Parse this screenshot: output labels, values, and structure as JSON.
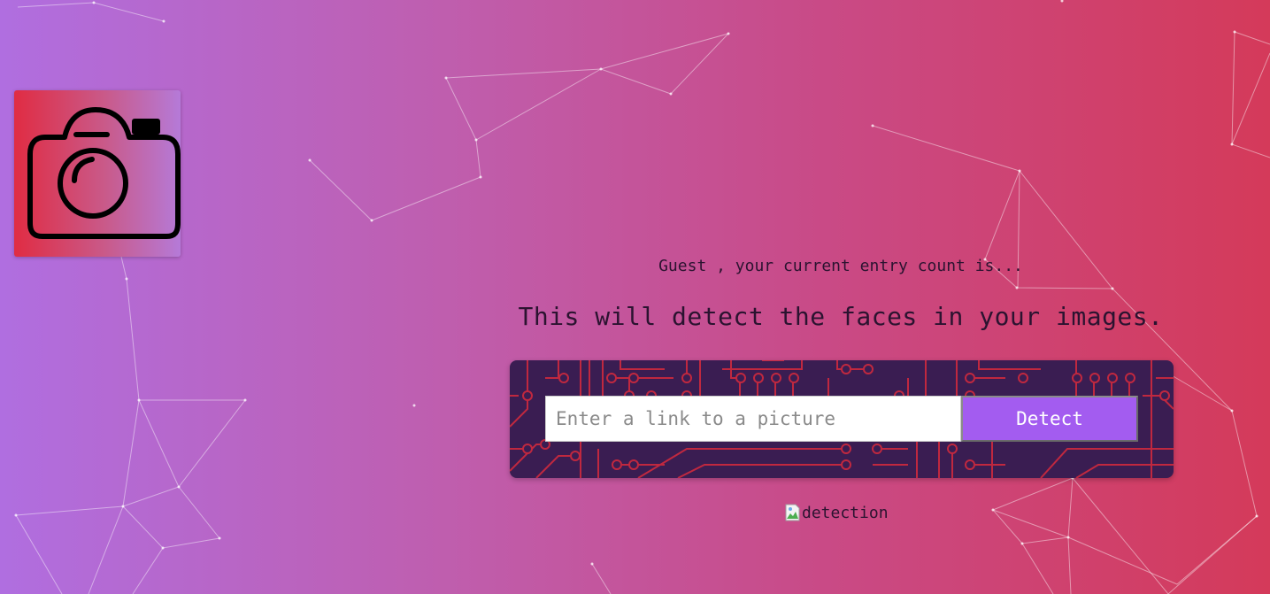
{
  "app": {
    "logo_icon": "camera-icon"
  },
  "colors": {
    "gradient_start": "#b06ee0",
    "gradient_end": "#d43a5a",
    "panel_bg": "#3a1d52",
    "circuit_trace": "#c0283f",
    "detect_button": "#a35cf0"
  },
  "greeting": {
    "text": "Guest , your current entry count is..."
  },
  "main": {
    "tagline": "This will detect the faces in your images."
  },
  "form": {
    "placeholder": "Enter a link to a picture",
    "value": "",
    "detect_label": "Detect"
  },
  "result": {
    "image_alt": "detection",
    "broken_image_icon": "broken-image-icon"
  }
}
